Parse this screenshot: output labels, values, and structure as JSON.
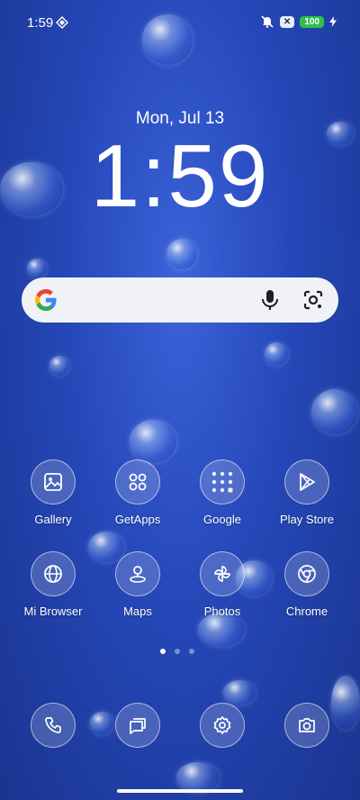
{
  "status_bar": {
    "time": "1:59",
    "badge": "✕",
    "battery": "100"
  },
  "lock": {
    "date": "Mon, Jul 13",
    "time": "1:59"
  },
  "apps": [
    {
      "label": "Gallery"
    },
    {
      "label": "GetApps"
    },
    {
      "label": "Google"
    },
    {
      "label": "Play Store"
    },
    {
      "label": "Mi Browser"
    },
    {
      "label": "Maps"
    },
    {
      "label": "Photos"
    },
    {
      "label": "Chrome"
    }
  ],
  "page_indicator": {
    "pages": 3,
    "current": 1
  },
  "colors": {
    "accent": "#2547b8",
    "search_bg": "#f1f2f6",
    "battery": "#2fbf4a"
  }
}
